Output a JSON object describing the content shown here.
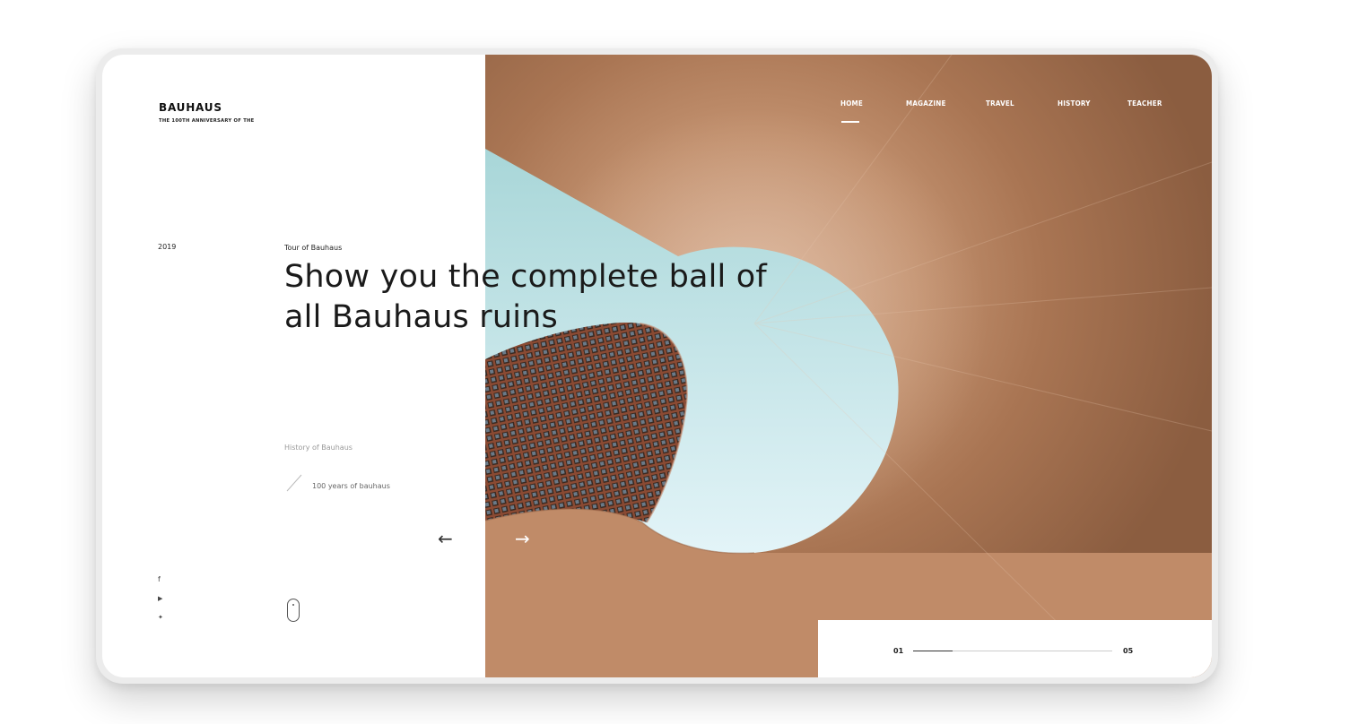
{
  "brand": {
    "name": "BAUHAUS",
    "tagline": "THE 100TH ANNIVERSARY OF THE"
  },
  "nav": {
    "items": [
      "HOME",
      "MAGAZINE",
      "TRAVEL",
      "HISTORY",
      "TEACHER"
    ],
    "active": "HOME"
  },
  "hero": {
    "year": "2019",
    "eyebrow": "Tour of Bauhaus",
    "headline_line1": "Show you the complete ball of",
    "headline_line2": "all Bauhaus ruins",
    "history_label": "History of Bauhaus",
    "years_label": "100 years of bauhaus"
  },
  "controls": {
    "prev_arrow": "←",
    "next_arrow": "→"
  },
  "social": {
    "facebook": "f",
    "youtube": "▶",
    "twitter": "✦"
  },
  "pager": {
    "current": "01",
    "total": "05",
    "progress": 0.2
  },
  "colors": {
    "sky": "#b2dde0",
    "concrete": "#b5805f",
    "text": "#1a1a1a"
  }
}
